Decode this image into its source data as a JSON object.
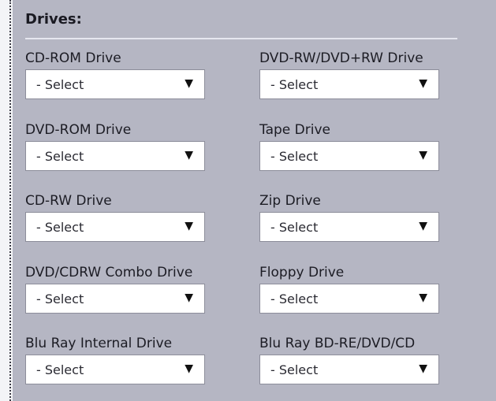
{
  "drives_panel": {
    "title": "Drives:",
    "fields": [
      {
        "label": "CD-ROM Drive",
        "value": "- Select"
      },
      {
        "label": "DVD-RW/DVD+RW Drive",
        "value": "- Select"
      },
      {
        "label": "DVD-ROM Drive",
        "value": "- Select"
      },
      {
        "label": "Tape Drive",
        "value": "- Select"
      },
      {
        "label": "CD-RW Drive",
        "value": "- Select"
      },
      {
        "label": "Zip Drive",
        "value": "- Select"
      },
      {
        "label": "DVD/CDRW Combo Drive",
        "value": "- Select"
      },
      {
        "label": "Floppy Drive",
        "value": "- Select"
      },
      {
        "label": "Blu Ray Internal Drive",
        "value": "- Select"
      },
      {
        "label": "Blu Ray BD-RE/DVD/CD",
        "value": "- Select"
      }
    ],
    "dropdown_arrow_glyph": "▼"
  },
  "colors": {
    "panel_background": "#b5b6c3",
    "select_background": "#ffffff",
    "divider": "#e6e7ef"
  }
}
